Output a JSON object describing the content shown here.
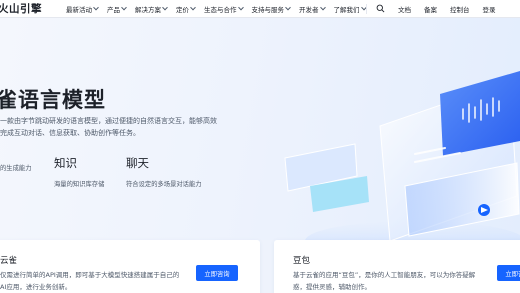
{
  "logo": "火山引擎",
  "nav": {
    "items": [
      {
        "label": "最新活动",
        "dropdown": true
      },
      {
        "label": "产品",
        "dropdown": true
      },
      {
        "label": "解决方案",
        "dropdown": true
      },
      {
        "label": "定价",
        "dropdown": true
      },
      {
        "label": "生态与合作",
        "dropdown": true
      },
      {
        "label": "支持与服务",
        "dropdown": true
      },
      {
        "label": "开发者",
        "dropdown": true
      },
      {
        "label": "了解我们",
        "dropdown": true
      }
    ],
    "right": [
      "文档",
      "备案",
      "控制台",
      "登录"
    ]
  },
  "hero": {
    "title": "雀语言模型",
    "description": "一款由字节跳动研发的语言模型，通过便捷的自然语言交互，能够高效完成互动对话、信息获取、协助创作等任务。",
    "features": [
      {
        "title": "",
        "desc": "的生成能力"
      },
      {
        "title": "知识",
        "desc": "海量的知识库存储"
      },
      {
        "title": "聊天",
        "desc": "符合设定的多场景对话能力"
      }
    ]
  },
  "cards": [
    {
      "title": "云雀",
      "desc": "仅需进行简单的API调用，即可基于大模型快速搭建属于自己的AI应用，进行业务创新。",
      "button": "立即咨询"
    },
    {
      "title": "豆包",
      "desc": "基于云雀的应用“豆包”，是你的人工智能朋友，可以为你答疑解惑，提供灵感，辅助创作。",
      "button": "立即咨询"
    }
  ],
  "colors": {
    "accent": "#1664ff",
    "text": "#1d2129",
    "secondary_text": "#4e5969",
    "hero_bg": "#eef3fc"
  }
}
